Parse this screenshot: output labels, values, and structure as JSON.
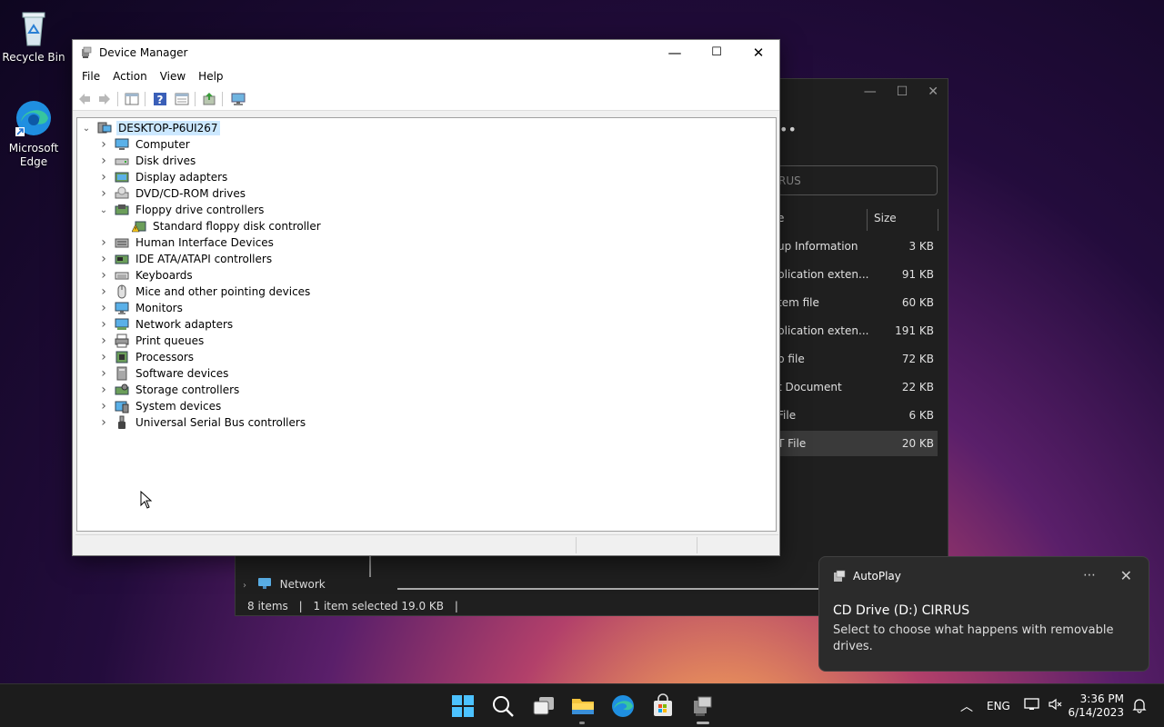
{
  "desktop": {
    "icons": [
      {
        "label": "Recycle Bin"
      },
      {
        "label": "Microsoft Edge"
      }
    ]
  },
  "explorer": {
    "search_text": "RUS",
    "column_name_fragment": "e",
    "column_size": "Size",
    "files": [
      {
        "name": "up Information",
        "size": "3 KB"
      },
      {
        "name": "plication exten...",
        "size": "91 KB"
      },
      {
        "name": "tem file",
        "size": "60 KB"
      },
      {
        "name": "plication exten...",
        "size": "191 KB"
      },
      {
        "name": "p file",
        "size": "72 KB"
      },
      {
        "name": "t Document",
        "size": "22 KB"
      },
      {
        "name": "File",
        "size": "6 KB"
      },
      {
        "name": "T File",
        "size": "20 KB",
        "selected": true
      }
    ],
    "nav_network": "Network",
    "status_items": "8 items",
    "status_selected": "1 item selected  19.0 KB"
  },
  "device_manager": {
    "title": "Device Manager",
    "menu": [
      "File",
      "Action",
      "View",
      "Help"
    ],
    "root": "DESKTOP-P6UI267",
    "nodes": [
      {
        "label": "Computer",
        "icon": "computer-icon",
        "expanded": false
      },
      {
        "label": "Disk drives",
        "icon": "disk-drive-icon",
        "expanded": false
      },
      {
        "label": "Display adapters",
        "icon": "display-adapter-icon",
        "expanded": false
      },
      {
        "label": "DVD/CD-ROM drives",
        "icon": "dvd-drive-icon",
        "expanded": false
      },
      {
        "label": "Floppy drive controllers",
        "icon": "floppy-controller-icon",
        "expanded": true
      },
      {
        "label": "Standard floppy disk controller",
        "icon": "warning-device-icon",
        "child": true
      },
      {
        "label": "Human Interface Devices",
        "icon": "hid-icon",
        "expanded": false
      },
      {
        "label": "IDE ATA/ATAPI controllers",
        "icon": "ide-controller-icon",
        "expanded": false
      },
      {
        "label": "Keyboards",
        "icon": "keyboard-icon",
        "expanded": false
      },
      {
        "label": "Mice and other pointing devices",
        "icon": "mouse-icon",
        "expanded": false
      },
      {
        "label": "Monitors",
        "icon": "monitor-icon",
        "expanded": false
      },
      {
        "label": "Network adapters",
        "icon": "network-adapter-icon",
        "expanded": false
      },
      {
        "label": "Print queues",
        "icon": "printer-icon",
        "expanded": false
      },
      {
        "label": "Processors",
        "icon": "processor-icon",
        "expanded": false
      },
      {
        "label": "Software devices",
        "icon": "software-device-icon",
        "expanded": false
      },
      {
        "label": "Storage controllers",
        "icon": "storage-controller-icon",
        "expanded": false
      },
      {
        "label": "System devices",
        "icon": "system-device-icon",
        "expanded": false
      },
      {
        "label": "Universal Serial Bus controllers",
        "icon": "usb-icon",
        "expanded": false
      }
    ]
  },
  "toast": {
    "app": "AutoPlay",
    "title": "CD Drive (D:) CIRRUS",
    "body": "Select to choose what happens with removable drives."
  },
  "taskbar": {
    "language": "ENG",
    "time": "3:36 PM",
    "date": "6/14/2023"
  },
  "colors": {
    "selection": "#cce8ff",
    "taskbar": "#1c1c1c",
    "toast_bg": "#2b2b2b"
  }
}
